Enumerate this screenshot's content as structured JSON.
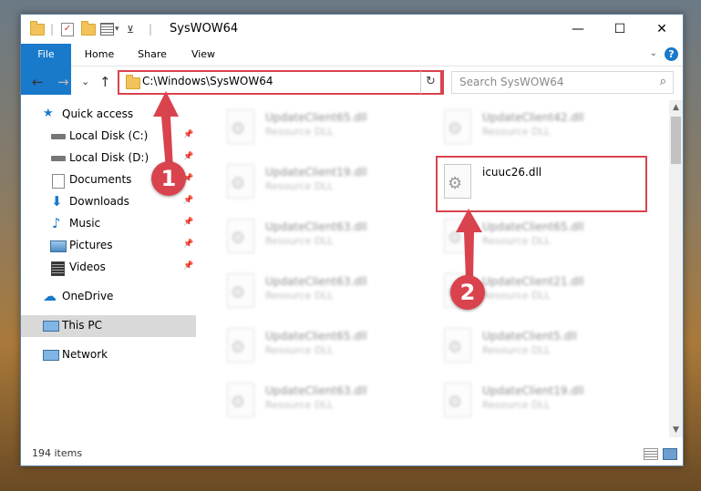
{
  "window": {
    "title": "SysWOW64",
    "minimize_glyph": "—",
    "maximize_glyph": "☐",
    "close_glyph": "✕"
  },
  "ribbon": {
    "tabs": [
      "File",
      "Home",
      "Share",
      "View"
    ],
    "help_glyph": "?",
    "collapse_glyph": "⌄"
  },
  "nav": {
    "back_glyph": "←",
    "forward_glyph": "→",
    "recent_glyph": "⌄",
    "up_glyph": "↑",
    "address": "C:\\Windows\\SysWOW64",
    "address_dropdown_glyph": "⌄",
    "refresh_glyph": "↻",
    "search_placeholder": "Search SysWOW64",
    "search_glyph": "⌕"
  },
  "sidebar": {
    "items": [
      {
        "label": "Quick access",
        "icon": "star-icon",
        "pinned": false
      },
      {
        "label": "Local Disk (C:)",
        "icon": "drive-icon",
        "pinned": true
      },
      {
        "label": "Local Disk (D:)",
        "icon": "drive-icon",
        "pinned": true
      },
      {
        "label": "Documents",
        "icon": "documents-icon",
        "pinned": true
      },
      {
        "label": "Downloads",
        "icon": "download-icon",
        "pinned": true
      },
      {
        "label": "Music",
        "icon": "music-icon",
        "pinned": true
      },
      {
        "label": "Pictures",
        "icon": "pictures-icon",
        "pinned": true
      },
      {
        "label": "Videos",
        "icon": "videos-icon",
        "pinned": true
      },
      {
        "label": "OneDrive",
        "icon": "cloud-icon",
        "pinned": false
      },
      {
        "label": "This PC",
        "icon": "computer-icon",
        "pinned": false,
        "selected": true
      },
      {
        "label": "Network",
        "icon": "network-icon",
        "pinned": false
      }
    ],
    "pin_glyph": "📌"
  },
  "files": {
    "left_column": [
      {
        "name": "UpdateClient65.dll",
        "type": "Resource DLL"
      },
      {
        "name": "UpdateClient19.dll",
        "type": "Resource DLL"
      },
      {
        "name": "UpdateClient63.dll",
        "type": "Resource DLL"
      },
      {
        "name": "UpdateClient63.dll",
        "type": "Resource DLL"
      },
      {
        "name": "UpdateClient65.dll",
        "type": "Resource DLL"
      },
      {
        "name": "UpdateClient63.dll",
        "type": "Resource DLL"
      }
    ],
    "right_column": [
      {
        "name": "UpdateClient42.dll",
        "type": "Resource DLL"
      },
      {
        "name": "icuuc26.dll",
        "type": "",
        "highlighted": true
      },
      {
        "name": "UpdateClient65.dll",
        "type": "Resource DLL"
      },
      {
        "name": "UpdateClient21.dll",
        "type": "Resource DLL"
      },
      {
        "name": "UpdateClient5.dll",
        "type": "Resource DLL"
      },
      {
        "name": "UpdateClient19.dll",
        "type": "Resource DLL"
      }
    ]
  },
  "status": {
    "item_count": "194 items"
  },
  "annotations": {
    "marker_1": "1",
    "marker_2": "2",
    "color": "#d9434e"
  }
}
